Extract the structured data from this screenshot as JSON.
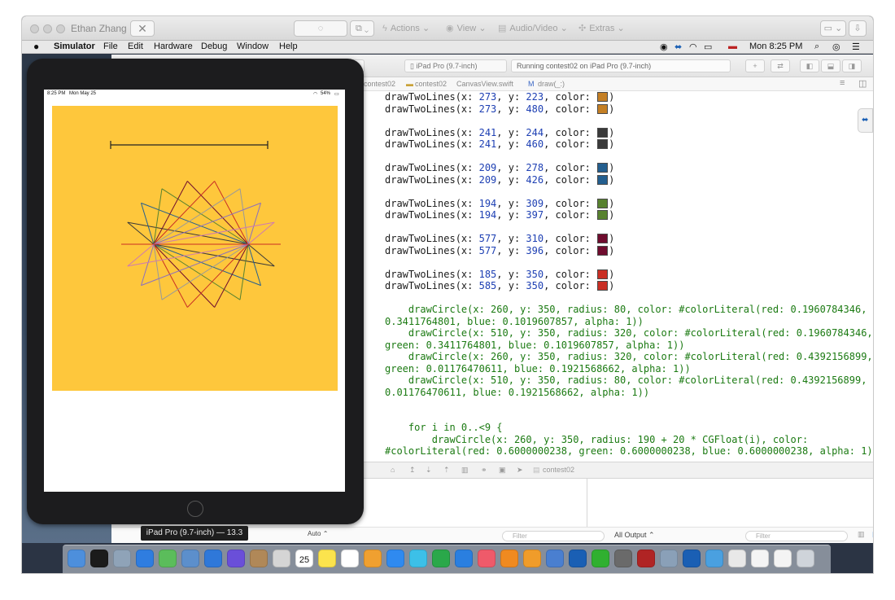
{
  "remote_toolbar": {
    "user_name": "Ethan Zhang",
    "menus": [
      {
        "label": "Actions",
        "icon": "bolt-icon"
      },
      {
        "label": "View",
        "icon": "eye-icon"
      },
      {
        "label": "Audio/Video",
        "icon": "speech-bubble-icon"
      },
      {
        "label": "Extras",
        "icon": "tools-icon"
      }
    ]
  },
  "menubar": {
    "app_name": "Simulator",
    "items": [
      "File",
      "Edit",
      "Hardware",
      "Debug",
      "Window",
      "Help"
    ],
    "clock": "Mon 8:25 PM"
  },
  "xcode": {
    "scheme_device": "iPad Pro (9.7-inch)",
    "status_text": "Running contest02 on iPad Pro (9.7-inch)",
    "breadcrumbs": [
      "contest02",
      "contest02",
      "CanvasView.swift",
      "draw(_:)"
    ],
    "code_lines": [
      {
        "kind": "call",
        "x": "273",
        "y": "223",
        "color": "#c47f24"
      },
      {
        "kind": "call",
        "x": "273",
        "y": "480",
        "color": "#c47f24"
      },
      {
        "kind": "blank"
      },
      {
        "kind": "call",
        "x": "241",
        "y": "244",
        "color": "#3a3a3a"
      },
      {
        "kind": "call",
        "x": "241",
        "y": "460",
        "color": "#3a3a3a"
      },
      {
        "kind": "blank"
      },
      {
        "kind": "call",
        "x": "209",
        "y": "278",
        "color": "#245f8f"
      },
      {
        "kind": "call",
        "x": "209",
        "y": "426",
        "color": "#245f8f"
      },
      {
        "kind": "blank"
      },
      {
        "kind": "call",
        "x": "194",
        "y": "309",
        "color": "#58822f"
      },
      {
        "kind": "call",
        "x": "194",
        "y": "397",
        "color": "#58822f"
      },
      {
        "kind": "blank"
      },
      {
        "kind": "call",
        "x": "577",
        "y": "310",
        "color": "#6f0c2e"
      },
      {
        "kind": "call",
        "x": "577",
        "y": "396",
        "color": "#6f0c2e"
      },
      {
        "kind": "blank"
      },
      {
        "kind": "call",
        "x": "185",
        "y": "350",
        "color": "#c92f24"
      },
      {
        "kind": "call",
        "x": "585",
        "y": "350",
        "color": "#c92f24"
      },
      {
        "kind": "blank"
      },
      {
        "kind": "text",
        "text": "    drawCircle(x: 260, y: 350, radius: 80, color: #colorLiteral(red: 0.1960784346, green:"
      },
      {
        "kind": "text",
        "text": "0.3411764801, blue: 0.1019607857, alpha: 1))"
      },
      {
        "kind": "text",
        "text": "    drawCircle(x: 510, y: 350, radius: 320, color: #colorLiteral(red: 0.1960784346,"
      },
      {
        "kind": "text",
        "text": "green: 0.3411764801, blue: 0.1019607857, alpha: 1))"
      },
      {
        "kind": "text",
        "text": "    drawCircle(x: 260, y: 350, radius: 320, color: #colorLiteral(red: 0.4392156899,"
      },
      {
        "kind": "text",
        "text": "green: 0.01176470611, blue: 0.1921568662, alpha: 1))"
      },
      {
        "kind": "text",
        "text": "    drawCircle(x: 510, y: 350, radius: 80, color: #colorLiteral(red: 0.4392156899, green:"
      },
      {
        "kind": "text",
        "text": "0.01176470611, blue: 0.1921568662, alpha: 1))"
      },
      {
        "kind": "blank"
      },
      {
        "kind": "blank"
      },
      {
        "kind": "text",
        "text": "    for i in 0..<9 {"
      },
      {
        "kind": "text",
        "text": "        drawCircle(x: 260, y: 350, radius: 190 + 20 * CGFloat(i), color:"
      },
      {
        "kind": "text",
        "text": "#colorLiteral(red: 0.6000000238, green: 0.6000000238, blue: 0.6000000238, alpha: 1))"
      }
    ],
    "debug_target": "contest02",
    "console": {
      "auto_label": "Auto",
      "filter_placeholder": "Filter",
      "output_label": "All Output"
    }
  },
  "simulator": {
    "status_time": "8:25 PM",
    "status_date": "Mon May 25",
    "battery": "54%",
    "device_tooltip": "iPad Pro (9.7-inch) — 13.3",
    "canvas_color": "#fec73c"
  },
  "dock": {
    "icons": [
      "finder-icon",
      "terminal-icon",
      "script-editor-icon",
      "xcode-icon",
      "playground-icon",
      "preview-icon",
      "safari-icon",
      "siri-icon",
      "contacts-icon",
      "photos-icon",
      "calendar-icon",
      "notes-icon",
      "reminders-icon",
      "photos-app-icon",
      "app-store-icon",
      "messages-icon",
      "numbers-icon",
      "keynote-icon",
      "music-icon",
      "books-icon",
      "pages-icon",
      "testflight-icon",
      "teamviewer-icon",
      "wechat-icon",
      "system-preferences-icon",
      "dictionary-icon",
      "image-capture-icon",
      "teamviewer2-icon",
      "folder-icon",
      "document-icon",
      "document2-icon",
      "document3-icon",
      "trash-icon"
    ],
    "calendar_day": "25"
  }
}
